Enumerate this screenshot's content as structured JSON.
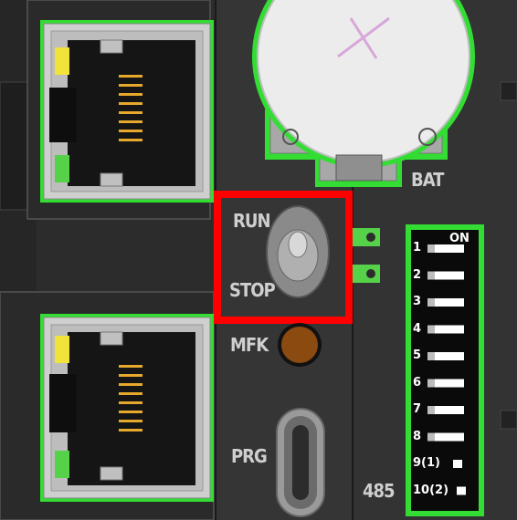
{
  "labels": {
    "run": "RUN",
    "stop": "STOP",
    "mfk": "MFK",
    "prg": "PRG",
    "bat": "BAT",
    "port485": "485",
    "dip_on": "ON"
  },
  "dip_switch": {
    "positions": [
      "1",
      "2",
      "3",
      "4",
      "5",
      "6",
      "7",
      "8",
      "9",
      "10"
    ],
    "sub_labels": [
      "",
      "",
      "",
      "",
      "",
      "",
      "",
      "",
      "(1)",
      "(2)"
    ]
  },
  "colors": {
    "highlight": "#ff0000",
    "board_outline": "#33dd33",
    "led_yellow": "#f2e33a",
    "led_green": "#55d14a",
    "mfk_led": "#8a4a10",
    "body": "#3a3a3a"
  },
  "icons": {
    "toggle_switch": "run-stop-toggle",
    "coin_battery": "battery-icon",
    "usb_port": "usb-c-port-icon"
  }
}
